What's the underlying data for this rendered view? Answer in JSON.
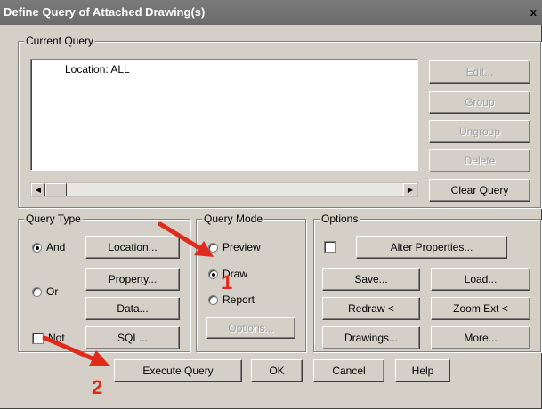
{
  "window": {
    "title": "Define Query of Attached Drawing(s)",
    "close_glyph": "x"
  },
  "current_query": {
    "label": "Current Query",
    "list_items": [
      "Location: ALL"
    ],
    "buttons": {
      "edit": "Edit...",
      "group": "Group",
      "ungroup": "Ungroup",
      "delete": "Delete",
      "clear": "Clear Query"
    }
  },
  "query_type": {
    "label": "Query Type",
    "and_label": "And",
    "or_label": "Or",
    "not_label": "Not",
    "selected": "And",
    "buttons": {
      "location": "Location...",
      "property": "Property...",
      "data": "Data...",
      "sql": "SQL..."
    }
  },
  "query_mode": {
    "label": "Query Mode",
    "preview_label": "Preview",
    "draw_label": "Draw",
    "report_label": "Report",
    "selected": "Draw",
    "options_button": "Options..."
  },
  "options": {
    "label": "Options",
    "alter_properties": "Alter Properties...",
    "save": "Save...",
    "load": "Load...",
    "redraw": "Redraw <",
    "zoom_ext": "Zoom Ext <",
    "drawings": "Drawings...",
    "more": "More..."
  },
  "footer": {
    "execute": "Execute Query",
    "ok": "OK",
    "cancel": "Cancel",
    "help": "Help"
  },
  "annotations": {
    "step1": "1",
    "step2": "2",
    "arrow_color": "#e02a1c"
  }
}
